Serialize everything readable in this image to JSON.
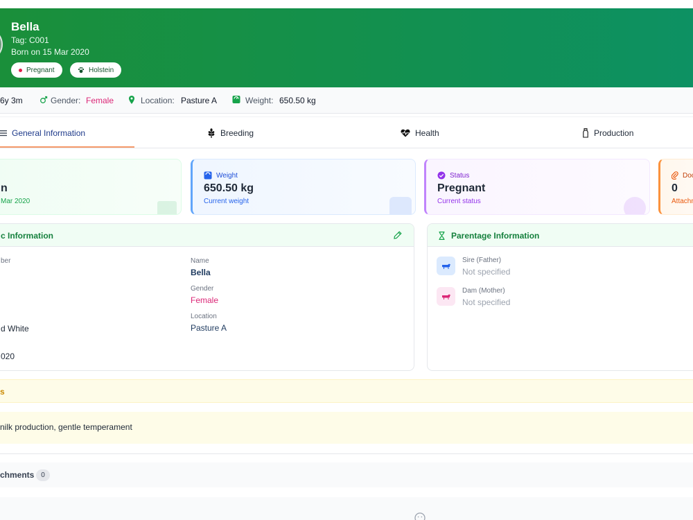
{
  "animal": {
    "name": "Bella",
    "tag": "Tag: C001",
    "born": "Born on 15 Mar 2020",
    "badges": [
      {
        "label": "Pregnant",
        "icon": "dot-icon"
      },
      {
        "label": "Holstein",
        "icon": "paw-icon"
      }
    ]
  },
  "meta": {
    "age": "6y 3m",
    "gender_label": "Gender:",
    "gender_value": "Female",
    "location_label": "Location:",
    "location_value": "Pasture A",
    "weight_label": "Weight:",
    "weight_value": "650.50 kg"
  },
  "tabs": [
    {
      "label": "General Information",
      "icon": "list-icon",
      "active": true
    },
    {
      "label": "Breeding",
      "icon": "wheat-icon",
      "active": false
    },
    {
      "label": "Health",
      "icon": "heart-pulse-icon",
      "active": false
    },
    {
      "label": "Production",
      "icon": "milk-bottle-icon",
      "active": false
    }
  ],
  "stats": [
    {
      "label": "",
      "value": "n",
      "sub": "Mar 2020",
      "accent": "#16a34a"
    },
    {
      "label": "Weight",
      "value": "650.50 kg",
      "sub": "Current weight",
      "accent": "#2563eb"
    },
    {
      "label": "Status",
      "value": "Pregnant",
      "sub": "Current status",
      "accent": "#9333ea"
    },
    {
      "label": "Doc",
      "value": "0",
      "sub": "Attachm",
      "accent": "#ea580c"
    }
  ],
  "basic_info": {
    "title": "c Information",
    "fields_left": [
      {
        "label": "ber",
        "value": ""
      },
      {
        "label": "",
        "value": ""
      },
      {
        "label": "",
        "value": "d White"
      },
      {
        "label": "",
        "value": "020"
      }
    ],
    "fields_right": [
      {
        "label": "Name",
        "value": "Bella"
      },
      {
        "label": "Gender",
        "value": "Female"
      },
      {
        "label": "Location",
        "value": "Pasture A"
      }
    ]
  },
  "parentage": {
    "title": "Parentage Information",
    "sire_label": "Sire (Father)",
    "sire_value": "Not specified",
    "dam_label": "Dam (Mother)",
    "dam_value": "Not specified"
  },
  "notes": {
    "title": "s",
    "text": "nilk production, gentle temperament"
  },
  "attachments": {
    "title": "chments",
    "count": "0"
  },
  "colors": {
    "primary_green": "#16a34a",
    "female_pink": "#db2777",
    "tab_active_underline": "#f59a6a"
  }
}
